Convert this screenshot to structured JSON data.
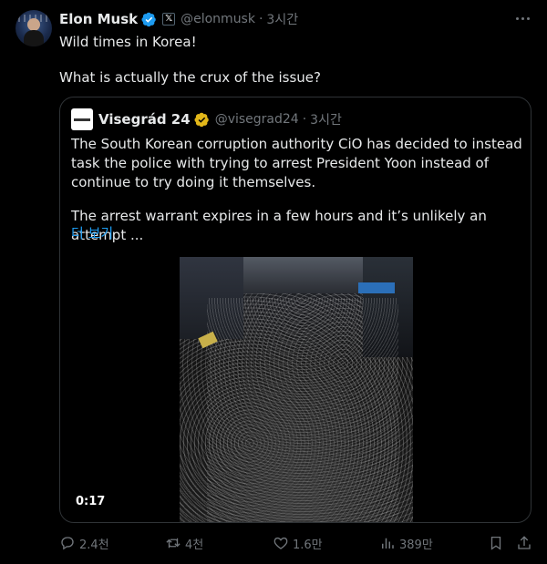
{
  "post": {
    "author_name": "Elon Musk",
    "x_badge": "𝕏",
    "handle": "@elonmusk",
    "separator": "·",
    "time": "3시간",
    "text_line1": "Wild times in Korea!",
    "text_line2": "What is actually the crux of the issue?"
  },
  "quote": {
    "author_name": "Visegrád 24",
    "handle": "@visegrad24",
    "separator": "·",
    "time": "3시간",
    "paragraph1": "The South Korean corruption authority CiO has decided to instead task the police with trying to arrest President Yoon instead of continue to try doing it themselves.",
    "paragraph2": "The arrest warrant expires in a few hours and it’s unlikely an attempt ...",
    "show_more": "더 보기",
    "video_time": "0:17"
  },
  "actions": {
    "replies": "2.4천",
    "reposts": "4천",
    "likes": "1.6만",
    "views": "389만"
  },
  "colors": {
    "background": "#000000",
    "text": "#e7e9ea",
    "muted": "#71767b",
    "link": "#1d9bf0",
    "verified_blue": "#1d9bf0",
    "verified_gold": "#e2b719",
    "border": "#2f3336"
  },
  "icons": [
    "verified-badge-icon",
    "more-icon",
    "reply-icon",
    "repost-icon",
    "like-icon",
    "views-icon",
    "bookmark-icon",
    "share-icon"
  ]
}
